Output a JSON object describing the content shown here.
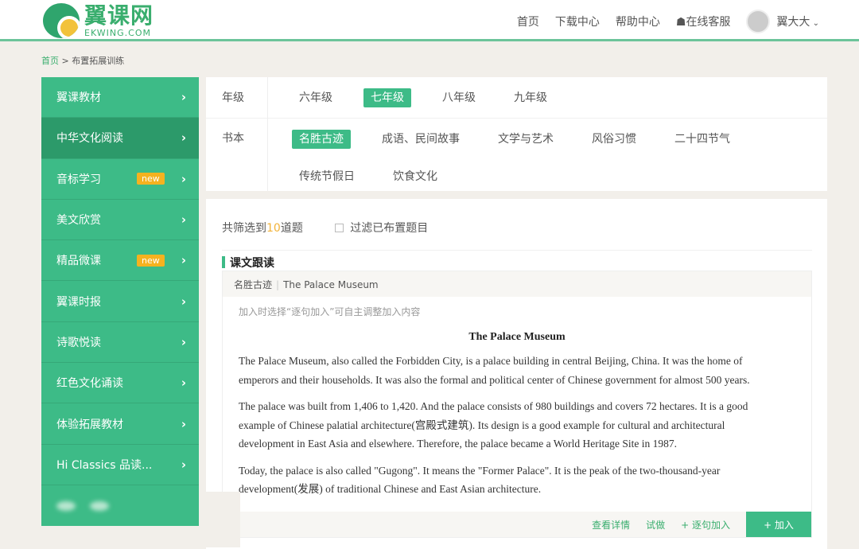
{
  "header": {
    "logo_cn": "翼课网",
    "logo_en": "EKWING.COM",
    "nav": [
      "首页",
      "下载中心",
      "帮助中心",
      "在线客服"
    ],
    "user": "翼大大"
  },
  "breadcrumb": {
    "home": "首页",
    "sep": ">",
    "current": "布置拓展训练"
  },
  "sidebar": {
    "items": [
      {
        "label": "翼课教材"
      },
      {
        "label": "中华文化阅读",
        "active": true
      },
      {
        "label": "音标学习",
        "badge": "new"
      },
      {
        "label": "美文欣赏"
      },
      {
        "label": "精品微课",
        "badge": "new"
      },
      {
        "label": "翼课时报"
      },
      {
        "label": "诗歌悦读"
      },
      {
        "label": "红色文化诵读"
      },
      {
        "label": "体验拓展教材"
      },
      {
        "label": "Hi Classics 品读..."
      }
    ]
  },
  "filter": {
    "grade_label": "年级",
    "grades": [
      "六年级",
      "七年级",
      "八年级",
      "九年级"
    ],
    "grade_selected": "七年级",
    "book_label": "书本",
    "books": [
      "名胜古迹",
      "成语、民间故事",
      "文学与艺术",
      "风俗习惯",
      "二十四节气",
      "传统节假日",
      "饮食文化"
    ],
    "book_selected": "名胜古迹"
  },
  "content": {
    "count_prefix": "共筛选到",
    "count": "10",
    "count_suffix": "道题",
    "filter_check": "过滤已布置题目",
    "section": "课文跟读",
    "card": {
      "category": "名胜古迹",
      "name": "The Palace Museum",
      "hint": "加入时选择“逐句加入”可自主调整加入内容",
      "title": "The Palace Museum",
      "paragraphs": [
        "The Palace Museum, also called the Forbidden City, is a palace building in central Beijing, China. It was the home of emperors and their households. It was also the formal and political center of Chinese government for almost 500 years.",
        "The palace was built from 1,406 to 1,420. And the palace consists of 980 buildings and covers 72 hectares. It is a good example of Chinese palatial architecture(宫殿式建筑). Its design is a good example for cultural and architectural development in East Asia and elsewhere. Therefore, the palace became a World Heritage Site in 1987.",
        "Today, the palace is also called \"Gugong\". It means the \"Former Palace\". It is the peak of the two-thousand-year development(发展) of traditional Chinese and East Asian architecture."
      ],
      "actions": {
        "details": "查看详情",
        "try": "试做",
        "add_sentence": "+ 逐句加入",
        "add": "+ 加入"
      }
    }
  },
  "colors": {
    "brand": "#3dbb87",
    "accent": "#f2b33a"
  }
}
